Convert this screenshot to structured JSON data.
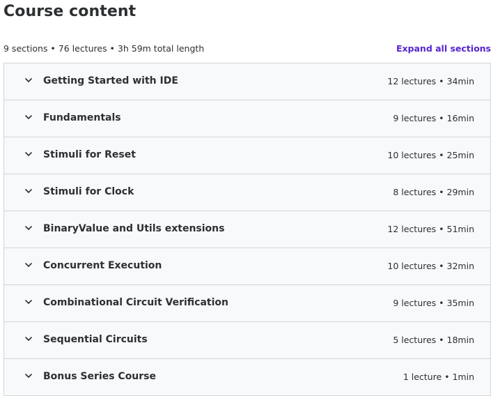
{
  "header": {
    "title": "Course content"
  },
  "summary": {
    "text": "9 sections • 76 lectures • 3h 59m total length",
    "expand_label": "Expand all sections"
  },
  "colors": {
    "accent": "#5624d0",
    "section_bg": "#f7f9fa",
    "border": "#d1d7dc",
    "text": "#2d2f31"
  },
  "sections": [
    {
      "title": "Getting Started with IDE",
      "meta": "12 lectures • 34min",
      "icon": "chevron-down-icon"
    },
    {
      "title": "Fundamentals",
      "meta": "9 lectures • 16min",
      "icon": "chevron-down-icon"
    },
    {
      "title": "Stimuli for Reset",
      "meta": "10 lectures • 25min",
      "icon": "chevron-down-icon"
    },
    {
      "title": "Stimuli for Clock",
      "meta": "8 lectures • 29min",
      "icon": "chevron-down-icon"
    },
    {
      "title": "BinaryValue and Utils extensions",
      "meta": "12 lectures • 51min",
      "icon": "chevron-down-icon"
    },
    {
      "title": "Concurrent Execution",
      "meta": "10 lectures • 32min",
      "icon": "chevron-down-icon"
    },
    {
      "title": "Combinational Circuit Verification",
      "meta": "9 lectures • 35min",
      "icon": "chevron-down-icon"
    },
    {
      "title": "Sequential Circuits",
      "meta": "5 lectures • 18min",
      "icon": "chevron-down-icon"
    },
    {
      "title": "Bonus Series Course",
      "meta": "1 lecture • 1min",
      "icon": "chevron-down-icon"
    }
  ]
}
